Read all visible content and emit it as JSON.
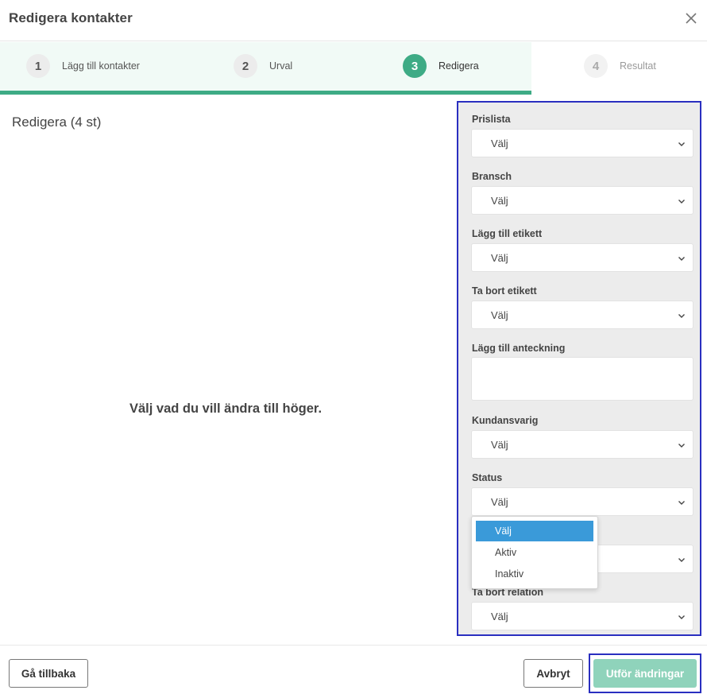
{
  "header": {
    "title": "Redigera kontakter"
  },
  "steps": [
    {
      "number": "1",
      "label": "Lägg till kontakter"
    },
    {
      "number": "2",
      "label": "Urval"
    },
    {
      "number": "3",
      "label": "Redigera"
    },
    {
      "number": "4",
      "label": "Resultat"
    }
  ],
  "main": {
    "title": "Redigera (4 st)",
    "hint": "Välj vad du vill ändra till höger."
  },
  "form": {
    "prislista": {
      "label": "Prislista",
      "value": "Välj"
    },
    "bransch": {
      "label": "Bransch",
      "value": "Välj"
    },
    "add_tag": {
      "label": "Lägg till etikett",
      "value": "Välj"
    },
    "remove_tag": {
      "label": "Ta bort etikett",
      "value": "Välj"
    },
    "add_note": {
      "label": "Lägg till anteckning"
    },
    "kundansvarig": {
      "label": "Kundansvarig",
      "value": "Välj"
    },
    "status": {
      "label": "Status",
      "value": "Välj"
    },
    "hidden_select": {
      "value": ""
    },
    "remove_relation": {
      "label": "Ta bort relation",
      "value": "Välj"
    }
  },
  "status_dropdown": {
    "options": [
      "Välj",
      "Aktiv",
      "Inaktiv"
    ]
  },
  "footer": {
    "back_label": "Gå tillbaka",
    "cancel_label": "Avbryt",
    "submit_label": "Utför ändringar"
  },
  "colors": {
    "accent": "#3eab85",
    "accent_light": "#8fd3bb",
    "selected_option": "#3a9ad9",
    "highlight_border": "#2a2fc0"
  }
}
